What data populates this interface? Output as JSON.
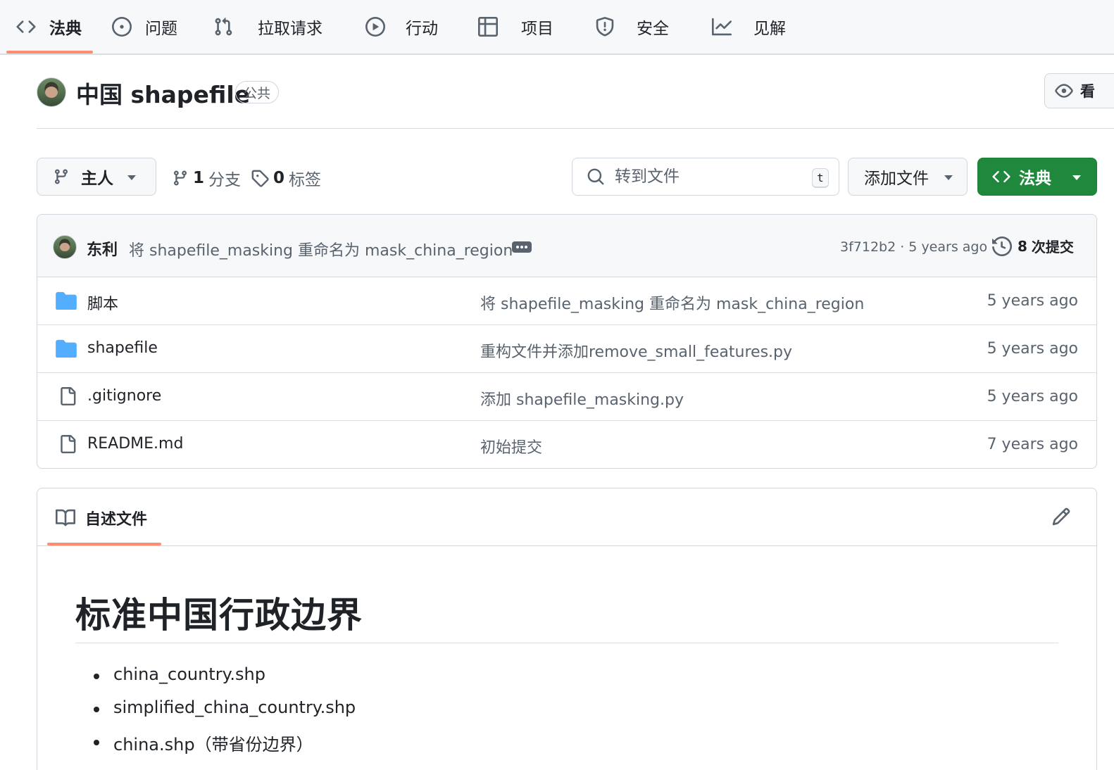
{
  "nav": {
    "tabs": [
      {
        "label": "法典",
        "icon": "code-icon",
        "active": true
      },
      {
        "label": "问题",
        "icon": "issue-opened-icon",
        "active": false
      },
      {
        "label": "拉取请求",
        "icon": "git-pull-request-icon",
        "active": false
      },
      {
        "label": "行动",
        "icon": "play-icon",
        "active": false
      },
      {
        "label": "项目",
        "icon": "table-icon",
        "active": false
      },
      {
        "label": "安全",
        "icon": "shield-icon",
        "active": false
      },
      {
        "label": "见解",
        "icon": "graph-icon",
        "active": false
      }
    ],
    "active_underline_color": "#fd8c73"
  },
  "repo": {
    "name": "中国 shapefile",
    "visibility": "公共",
    "watch_label": "看"
  },
  "toolbar": {
    "branch_label": "主人",
    "branch_count": "1",
    "branch_count_label": "分支",
    "tag_count": "0",
    "tag_count_label": "标签",
    "search_placeholder": "转到文件",
    "search_shortcut": "t",
    "add_file_label": "添加文件",
    "code_button_label": "法典",
    "code_button_color": "#1f883d"
  },
  "latest_commit": {
    "author": "东利",
    "message": "将 shapefile_masking 重命名为 mask_china_region",
    "hash_time": "3f712b2 · 5 years ago",
    "commit_count": "8",
    "commit_count_label": "次提交"
  },
  "files": [
    {
      "name": "脚本",
      "type": "folder",
      "icon": "folder-icon",
      "message": "将 shapefile_masking 重命名为 mask_china_region",
      "date": "5 years ago"
    },
    {
      "name": "shapefile",
      "type": "folder",
      "icon": "folder-icon",
      "message": "重构文件并添加remove_small_features.py",
      "date": "5 years ago"
    },
    {
      "name": ".gitignore",
      "type": "file",
      "icon": "file-icon",
      "message": "添加 shapefile_masking.py",
      "date": "5 years ago"
    },
    {
      "name": "README.md",
      "type": "file",
      "icon": "file-icon",
      "message": "初始提交",
      "date": "7 years ago"
    }
  ],
  "readme": {
    "tab_label": "自述文件",
    "heading": "标准中国行政边界",
    "items": [
      "china_country.shp",
      "simplified_china_country.shp",
      "china.shp（带省份边界）"
    ]
  }
}
